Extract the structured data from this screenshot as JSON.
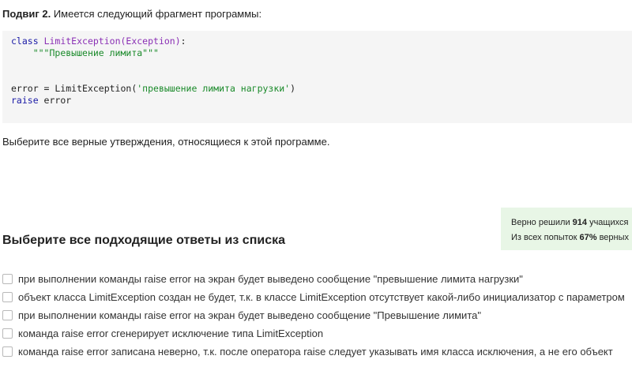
{
  "intro": {
    "label": "Подвиг 2.",
    "text": " Имеется следующий фрагмент программы:"
  },
  "code": {
    "line1_kw": "class",
    "line1_cls": "LimitException(Exception)",
    "line1_rest": ":",
    "line2_str": "\"\"\"Превышение лимита\"\"\"",
    "line3_pre": "error = LimitException(",
    "line3_str": "'превышение лимита нагрузки'",
    "line3_post": ")",
    "line4_kw": "raise",
    "line4_rest": " error"
  },
  "question": "Выберите все верные утверждения, относящиеся к этой программе.",
  "stats": {
    "solved_prefix": "Верно решили ",
    "solved_count": "914",
    "solved_suffix": " учащихся",
    "attempts_prefix": "Из всех попыток ",
    "attempts_percent": "67%",
    "attempts_suffix": " верных"
  },
  "answers_title": "Выберите все подходящие ответы из списка",
  "options": [
    "при выполнении команды raise error на экран будет выведено сообщение \"превышение лимита нагрузки\"",
    "объект класса LimitException создан не будет, т.к. в классе LimitException отсутствует какой-либо инициализатор с параметром",
    "при выполнении команды raise error на экран будет выведено сообщение \"Превышение лимита\"",
    "команда raise error сгенерирует исключение типа LimitException",
    "команда raise error записана неверно, т.к. после оператора raise следует указывать имя класса исключения, а не его объект"
  ]
}
